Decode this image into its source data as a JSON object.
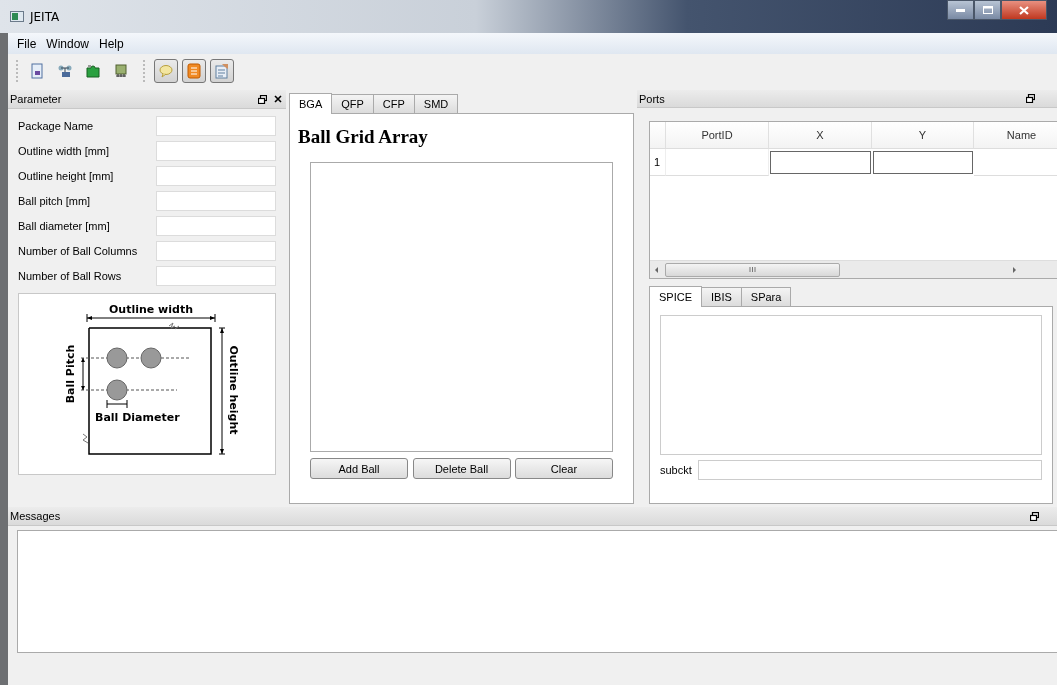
{
  "window": {
    "title": "JEITA"
  },
  "menu": [
    "File",
    "Window",
    "Help"
  ],
  "toolbar": {
    "toggles": [
      {
        "kind": "balloon",
        "checked": true
      },
      {
        "kind": "list",
        "checked": true
      },
      {
        "kind": "notes",
        "checked": true
      }
    ]
  },
  "parameter_panel": {
    "title": "Parameter",
    "fields": [
      {
        "label": "Package Name"
      },
      {
        "label": "Outline width [mm]"
      },
      {
        "label": "Outline height [mm]"
      },
      {
        "label": "Ball pitch [mm]"
      },
      {
        "label": "Ball diameter [mm]"
      },
      {
        "label": "Number of Ball Columns"
      },
      {
        "label": "Number of Ball Rows"
      }
    ],
    "diagram": {
      "outline_width": "Outline width",
      "ball_pitch": "Ball Pitch",
      "ball_diameter": "Ball Diameter",
      "outline_height": "Outline height"
    }
  },
  "package_tabs": [
    {
      "label": "BGA",
      "selected": true
    },
    {
      "label": "QFP",
      "selected": false
    },
    {
      "label": "CFP",
      "selected": false
    },
    {
      "label": "SMD",
      "selected": false
    }
  ],
  "package_view": {
    "heading": "Ball Grid Array",
    "buttons": [
      "Add Ball",
      "Delete Ball",
      "Clear"
    ]
  },
  "ports_panel": {
    "title": "Ports",
    "table": {
      "columns": [
        "PortID",
        "X",
        "Y",
        "Name"
      ],
      "rows": [
        {
          "header": "1"
        }
      ]
    },
    "model_tabs": [
      {
        "label": "SPICE",
        "selected": true
      },
      {
        "label": "IBIS",
        "selected": false
      },
      {
        "label": "SPara",
        "selected": false
      }
    ],
    "subckt": {
      "label": "subckt"
    }
  },
  "messages_panel": {
    "title": "Messages"
  }
}
